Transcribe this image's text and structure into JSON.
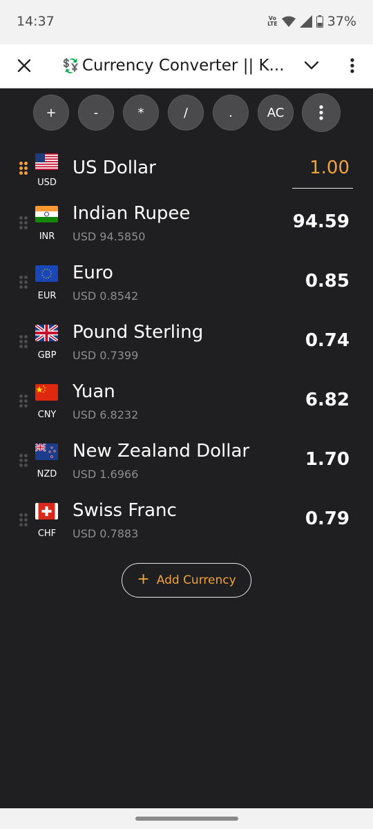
{
  "status": {
    "time": "14:37",
    "volte": "Vo\nLTE",
    "battery": "37%"
  },
  "tab": {
    "title_icon": "💱",
    "title": "Currency Converter || K..."
  },
  "operators": [
    "+",
    "-",
    "*",
    "/",
    ".",
    "AC"
  ],
  "currencies": [
    {
      "code": "USD",
      "name": "US Dollar",
      "rate": "",
      "amount": "1.00",
      "flag": "us"
    },
    {
      "code": "INR",
      "name": "Indian Rupee",
      "rate": "USD 94.5850",
      "amount": "94.59",
      "flag": "in"
    },
    {
      "code": "EUR",
      "name": "Euro",
      "rate": "USD 0.8542",
      "amount": "0.85",
      "flag": "eu"
    },
    {
      "code": "GBP",
      "name": "Pound Sterling",
      "rate": "USD 0.7399",
      "amount": "0.74",
      "flag": "gb"
    },
    {
      "code": "CNY",
      "name": "Yuan",
      "rate": "USD 6.8232",
      "amount": "6.82",
      "flag": "cn"
    },
    {
      "code": "NZD",
      "name": "New Zealand Dollar",
      "rate": "USD 1.6966",
      "amount": "1.70",
      "flag": "nz"
    },
    {
      "code": "CHF",
      "name": "Swiss Franc",
      "rate": "USD 0.7883",
      "amount": "0.79",
      "flag": "ch"
    }
  ],
  "add_button": {
    "label": "Add Currency"
  },
  "colors": {
    "accent": "#f4a23a",
    "background": "#1f1f21",
    "operator_bg": "#4a4a4c"
  }
}
